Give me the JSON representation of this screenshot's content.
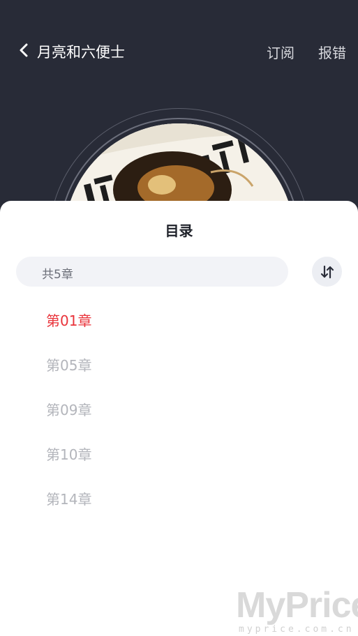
{
  "header": {
    "title": "月亮和六便士",
    "subscribe_label": "订阅",
    "report_label": "报错"
  },
  "sheet": {
    "title": "目录",
    "chapter_count": "共5章",
    "chapters": [
      {
        "label": "第01章",
        "active": true
      },
      {
        "label": "第05章",
        "active": false
      },
      {
        "label": "第09章",
        "active": false
      },
      {
        "label": "第10章",
        "active": false
      },
      {
        "label": "第14章",
        "active": false
      }
    ]
  },
  "icons": {
    "back": "chevron-left-icon",
    "sort": "sort-arrows-icon"
  },
  "colors": {
    "header_bg": "#282b37",
    "active_chapter": "#e9333a",
    "inactive_chapter": "#b3b5bb"
  },
  "watermark": {
    "main": "MyPrice",
    "sub": "myprice.com.cn"
  }
}
